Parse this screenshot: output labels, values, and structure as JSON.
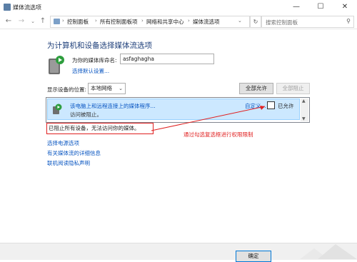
{
  "window": {
    "title": "媒体流选项",
    "minimize": "—",
    "maximize": "☐",
    "close": "✕"
  },
  "addressbar": {
    "back_icon": "arrow-left",
    "forward_icon": "arrow-right",
    "recent_icon": "chevron-down",
    "up_icon": "arrow-up",
    "breadcrumbs": [
      "控制面板",
      "所有控制面板项",
      "网络和共享中心",
      "媒体流选项"
    ],
    "search_placeholder": "搜索控制面板"
  },
  "main": {
    "heading": "为计算机和设备选择媒体流选项",
    "library_label": "为你的媒体库命名:",
    "library_value": "asfaghagha",
    "default_link": "选择默认设置...",
    "show_devices_label": "显示设备的位置:",
    "show_devices_value": "本地网络",
    "allow_all_button": "全部允许",
    "block_all_button": "全部阻止"
  },
  "device": {
    "name": "该电脑上和远程连接上的媒体程序...",
    "status": "访问被阻止。",
    "custom_link": "自定义...",
    "allow_label": "已允许",
    "allowed": false
  },
  "blocked_message": "已阻止所有设备，无法访问你的媒体。",
  "annotation": "通过勾选复选框进行权限限制",
  "links": [
    "选择电源选项",
    "有关媒体流的详细信息",
    "联机阅读隐私声明"
  ],
  "footer": {
    "ok_button": "确定"
  },
  "colors": {
    "accent": "#0078d7",
    "link": "#0b57c2",
    "heading": "#1e3f7a",
    "annotation": "#e02020",
    "selection": "#cce8ff"
  }
}
